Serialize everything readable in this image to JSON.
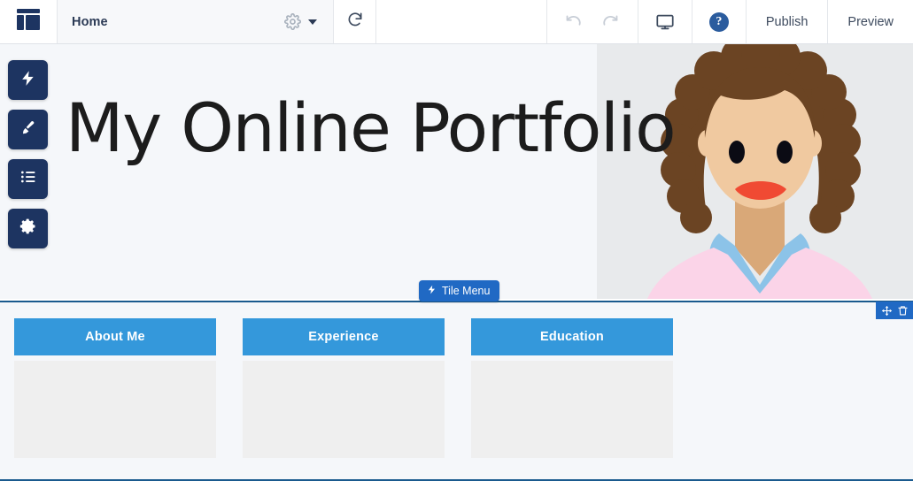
{
  "app": {
    "logo_icon": "layout-grid-icon"
  },
  "topbar": {
    "page_name": "Home",
    "page_settings_icon": "gear-icon",
    "page_dropdown_icon": "chevron-down-icon",
    "reload_icon": "reload-icon",
    "undo_icon": "undo-icon",
    "redo_icon": "redo-icon",
    "device_preview_icon": "desktop-monitor-icon",
    "help_icon": "question-mark-icon",
    "help_label": "?",
    "publish_label": "Publish",
    "preview_label": "Preview"
  },
  "rail": {
    "items": [
      {
        "icon": "lightning-bolt-icon",
        "name": "tile-menu-tool"
      },
      {
        "icon": "paint-brush-icon",
        "name": "design-tool"
      },
      {
        "icon": "list-icon",
        "name": "pages-tool"
      },
      {
        "icon": "gear-icon",
        "name": "settings-tool"
      }
    ]
  },
  "hero": {
    "title": "My Online Portfolio",
    "background_left": "#f5f7fa",
    "background_right": "#e8eaec",
    "illustration": "woman-avatar-illustration"
  },
  "tile_menu_pill": {
    "label": "Tile Menu",
    "icon": "lightning-bolt-icon",
    "color": "#2069c4"
  },
  "selection": {
    "border_color": "#1a5a8e",
    "toolbar": {
      "move_icon": "move-arrows-icon",
      "delete_icon": "trash-icon",
      "background": "#2069c4"
    }
  },
  "tiles": {
    "accent_color": "#3498db",
    "items": [
      {
        "label": "About Me"
      },
      {
        "label": "Experience"
      },
      {
        "label": "Education"
      }
    ]
  }
}
